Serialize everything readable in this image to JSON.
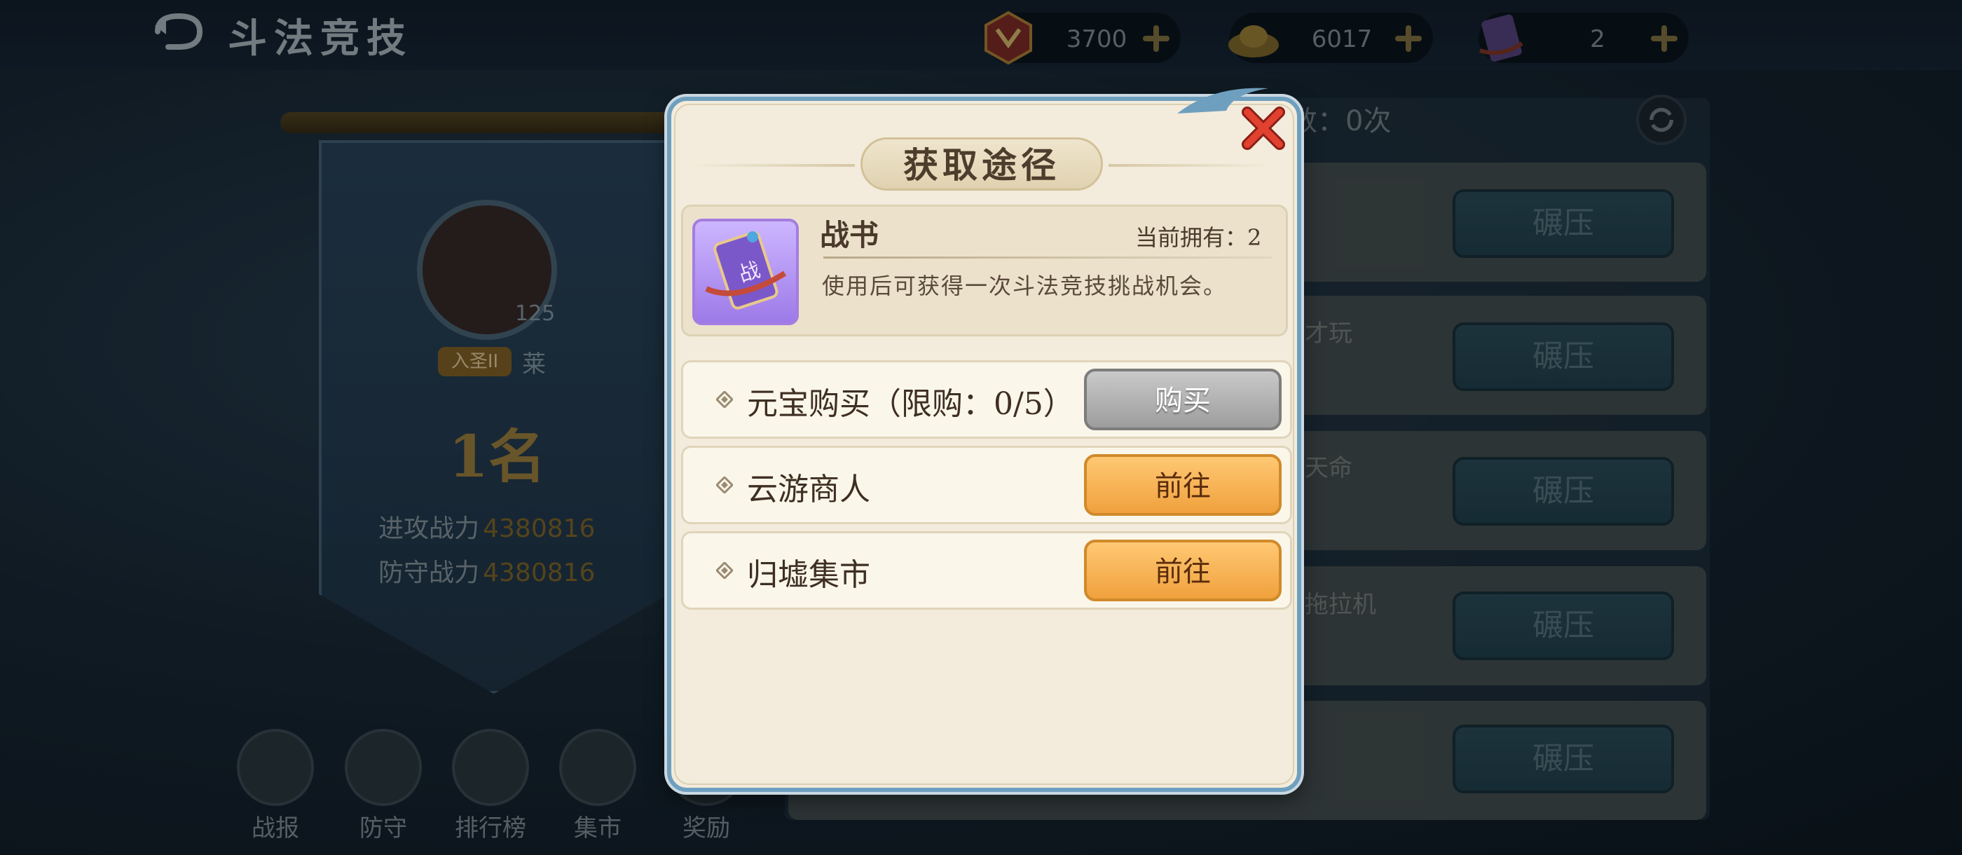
{
  "header": {
    "title": "斗法竞技",
    "currencies": [
      {
        "icon": "token-icon",
        "value": "3700"
      },
      {
        "icon": "gold-ingot-icon",
        "value": "6017"
      },
      {
        "icon": "battle-scroll-icon",
        "value": "2"
      }
    ]
  },
  "player": {
    "level": "125",
    "rank_tag": "入圣II",
    "rank_extra": "莱",
    "rank": "1名",
    "attack_label": "进攻战力",
    "attack_value": "4380816",
    "defense_label": "防守战力",
    "defense_value": "4380816"
  },
  "bottom_nav": [
    {
      "label": "战报",
      "icon": "battle-report-icon"
    },
    {
      "label": "防守",
      "icon": "defense-icon"
    },
    {
      "label": "排行榜",
      "icon": "leaderboard-icon"
    },
    {
      "label": "集市",
      "icon": "market-icon"
    },
    {
      "label": "奖励",
      "icon": "reward-icon"
    }
  ],
  "opponents": {
    "challenge_count_text": "数：0次",
    "rows": [
      {
        "name": "",
        "button": "碾压"
      },
      {
        "name": "才玩",
        "button": "碾压"
      },
      {
        "name": "天命",
        "button": "碾压"
      },
      {
        "name": "拖拉机",
        "button": "碾压"
      },
      {
        "name": "",
        "button": "碾压"
      }
    ]
  },
  "modal": {
    "title": "获取途径",
    "item": {
      "name": "战书",
      "icon_glyph": "战",
      "owned_text": "当前拥有：2",
      "description": "使用后可获得一次斗法竞技挑战机会。"
    },
    "sources": [
      {
        "label": "元宝购买（限购：0/5）",
        "button": "购买",
        "style": "gray"
      },
      {
        "label": "云游商人",
        "button": "前往",
        "style": "orange"
      },
      {
        "label": "归墟集市",
        "button": "前往",
        "style": "orange"
      }
    ]
  },
  "colors": {
    "modal_bg": "#f3ecdc",
    "modal_border": "#6f9fbe",
    "close_red": "#d8392b",
    "orange_button": "#f0a13d",
    "gray_button": "#9d9d9d"
  }
}
